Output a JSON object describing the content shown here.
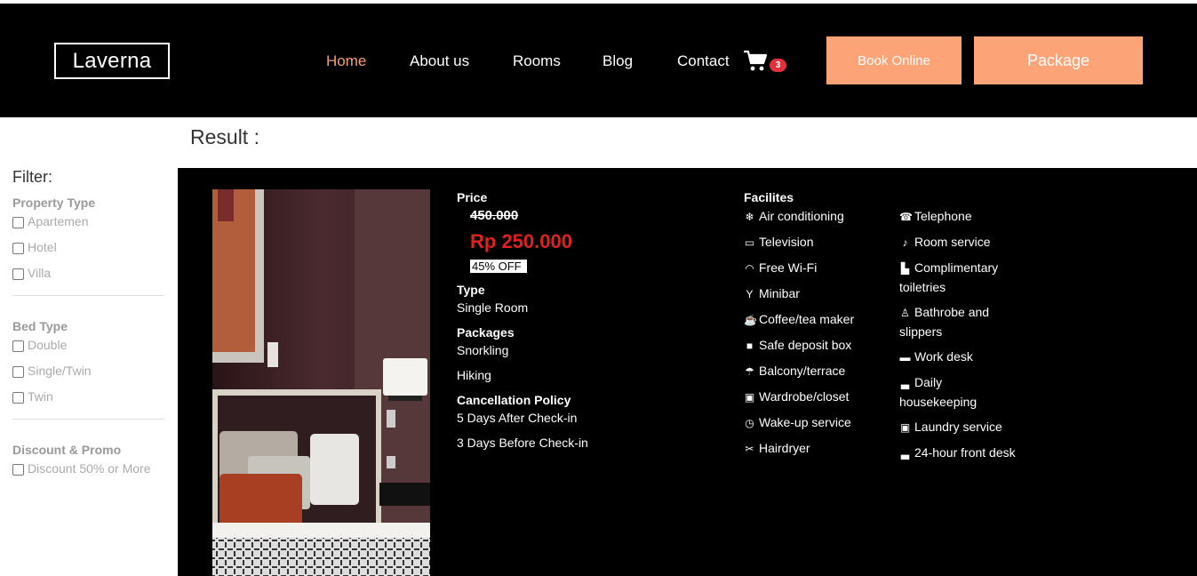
{
  "header": {
    "logo": "Laverna",
    "nav": [
      {
        "label": "Home",
        "active": true
      },
      {
        "label": "About us",
        "active": false
      },
      {
        "label": "Rooms",
        "active": false
      },
      {
        "label": "Blog",
        "active": false
      },
      {
        "label": "Contact",
        "active": false
      }
    ],
    "cart_count": "3",
    "book_online": "Book Online",
    "package": "Package"
  },
  "result_title": "Result :",
  "filter": {
    "title": "Filter:",
    "groups": [
      {
        "title": "Property Type",
        "options": [
          "Apartemen",
          "Hotel",
          "Villa"
        ]
      },
      {
        "title": "Bed Type",
        "options": [
          "Double",
          "Single/Twin",
          "Twin"
        ]
      },
      {
        "title": "Discount & Promo",
        "options": [
          "Discount 50% or More"
        ]
      }
    ]
  },
  "listing": {
    "price_label": "Price",
    "old_price": "450.000",
    "new_price": "Rp 250.000",
    "discount": "45% OFF",
    "type_label": "Type",
    "type_value": "Single Room",
    "packages_label": "Packages",
    "packages": [
      "Snorkling",
      "Hiking"
    ],
    "cancel_label": "Cancellation Policy",
    "cancel": [
      "5 Days After Check-in",
      "3 Days Before Check-in"
    ],
    "facilities_label": "Facilites",
    "facilities_left": [
      {
        "icon": "snowflake-icon",
        "label": "Air conditioning"
      },
      {
        "icon": "television-icon",
        "label": "Television"
      },
      {
        "icon": "wifi-icon",
        "label": "Free Wi-Fi"
      },
      {
        "icon": "cocktail-icon",
        "label": "Minibar"
      },
      {
        "icon": "coffee-icon",
        "label": "Coffee/tea maker"
      },
      {
        "icon": "lock-icon",
        "label": "Safe deposit box"
      },
      {
        "icon": "umbrella-icon",
        "label": "Balcony/terrace"
      },
      {
        "icon": "wardrobe-icon",
        "label": "Wardrobe/closet"
      },
      {
        "icon": "clock-icon",
        "label": "Wake-up service"
      },
      {
        "icon": "scissors-icon",
        "label": "Hairdryer"
      }
    ],
    "facilities_right": [
      {
        "icon": "phone-icon",
        "label": "Telephone"
      },
      {
        "icon": "bell-icon",
        "label": "Room service"
      },
      {
        "icon": "bath-icon",
        "label": "Complimentary toiletries"
      },
      {
        "icon": "person-icon",
        "label": "Bathrobe and slippers"
      },
      {
        "icon": "briefcase-icon",
        "label": "Work desk"
      },
      {
        "icon": "bed-icon",
        "label": "Daily housekeeping"
      },
      {
        "icon": "laundry-icon",
        "label": "Laundry service"
      },
      {
        "icon": "bed-icon",
        "label": "24-hour front desk"
      }
    ]
  },
  "colors": {
    "accent": "#fca377",
    "nav_active": "#f4a07a",
    "price": "#e0221e",
    "badge": "#e0313c"
  }
}
